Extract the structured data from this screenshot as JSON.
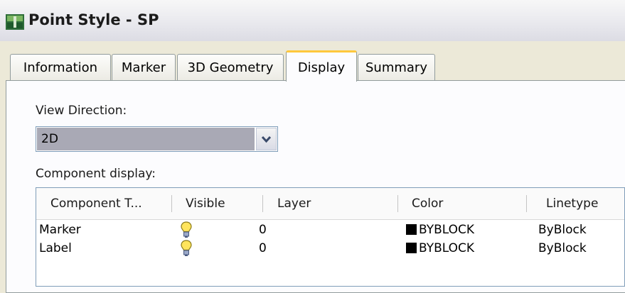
{
  "window": {
    "title": "Point Style - SP"
  },
  "tabs": [
    {
      "label": "Information",
      "active": false
    },
    {
      "label": "Marker",
      "active": false
    },
    {
      "label": "3D Geometry",
      "active": false
    },
    {
      "label": "Display",
      "active": true
    },
    {
      "label": "Summary",
      "active": false
    }
  ],
  "view_direction": {
    "label": "View Direction:",
    "value": "2D"
  },
  "component_display": {
    "label": "Component display:",
    "columns": [
      "Component T...",
      "Visible",
      "Layer",
      "Color",
      "Linetype"
    ],
    "rows": [
      {
        "component": "Marker",
        "visible_icon": "lightbulb-on-icon",
        "layer": "0",
        "color": "BYBLOCK",
        "color_hex": "#000000",
        "linetype": "ByBlock"
      },
      {
        "component": "Label",
        "visible_icon": "lightbulb-on-icon",
        "layer": "0",
        "color": "BYBLOCK",
        "color_hex": "#000000",
        "linetype": "ByBlock"
      }
    ]
  },
  "colors": {
    "active_tab_accent": "#ffc83c",
    "selected_combo_bg": "#a9a9b5"
  }
}
